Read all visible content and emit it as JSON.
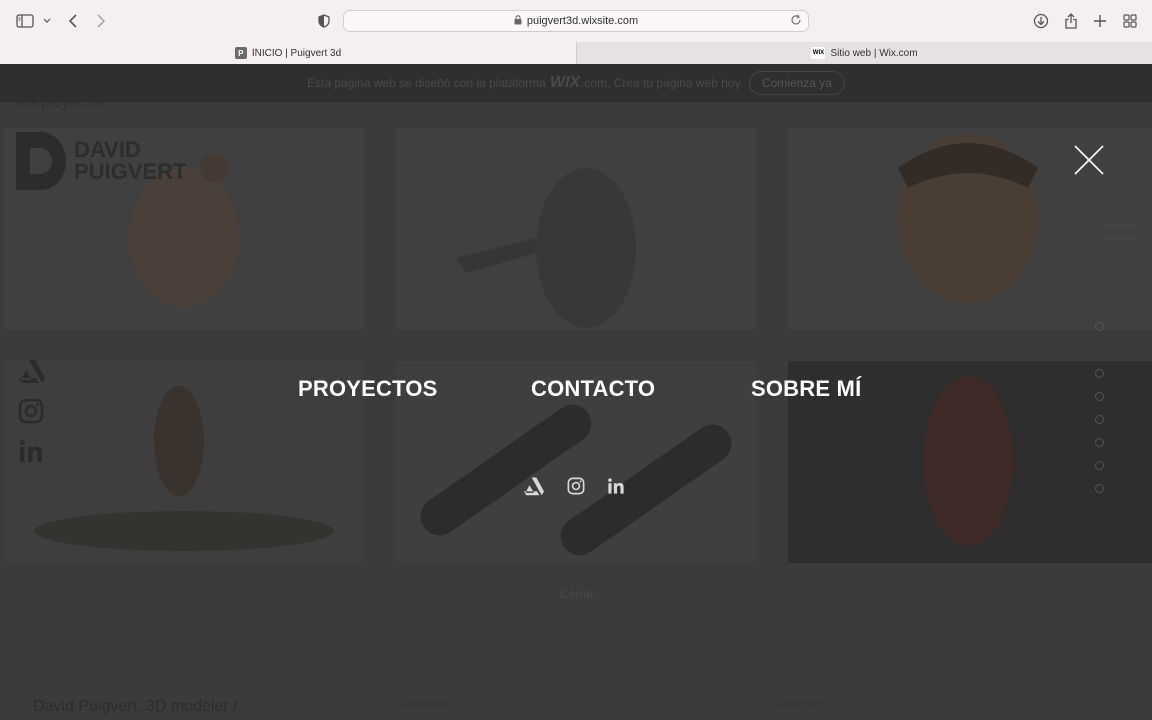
{
  "browser": {
    "url": "puigvert3d.wixsite.com",
    "tabs": [
      {
        "title": "INICIO | Puigvert 3d",
        "favicon": "P",
        "active": true
      },
      {
        "title": "Sitio web | Wix.com",
        "favicon": "WIX",
        "active": false
      }
    ]
  },
  "wix_banner": {
    "text_before": "Esta página web se diseñó con la plataforma",
    "logo": "WIX",
    "text_after": ".com. Crea tu página web hoy.",
    "cta": "Comienza ya"
  },
  "page": {
    "section_heading": "Mis proyectos",
    "logo_lines": [
      "DAVID",
      "PUIGVERT"
    ],
    "close_text": "Cerrar",
    "footer_name": "David Puigvert. 3D modeler /",
    "footer_col2": "Contacto",
    "footer_col3": "Síguenos"
  },
  "menu": {
    "items": [
      "PROYECTOS",
      "CONTACTO",
      "SOBRE MÍ"
    ],
    "social_icons": [
      "artstation-icon",
      "instagram-icon",
      "linkedin-icon"
    ]
  },
  "colors": {
    "overlay_text": "#ffffff",
    "page_bg": "#3b3b3b",
    "chrome_bg": "#f6eff2"
  }
}
